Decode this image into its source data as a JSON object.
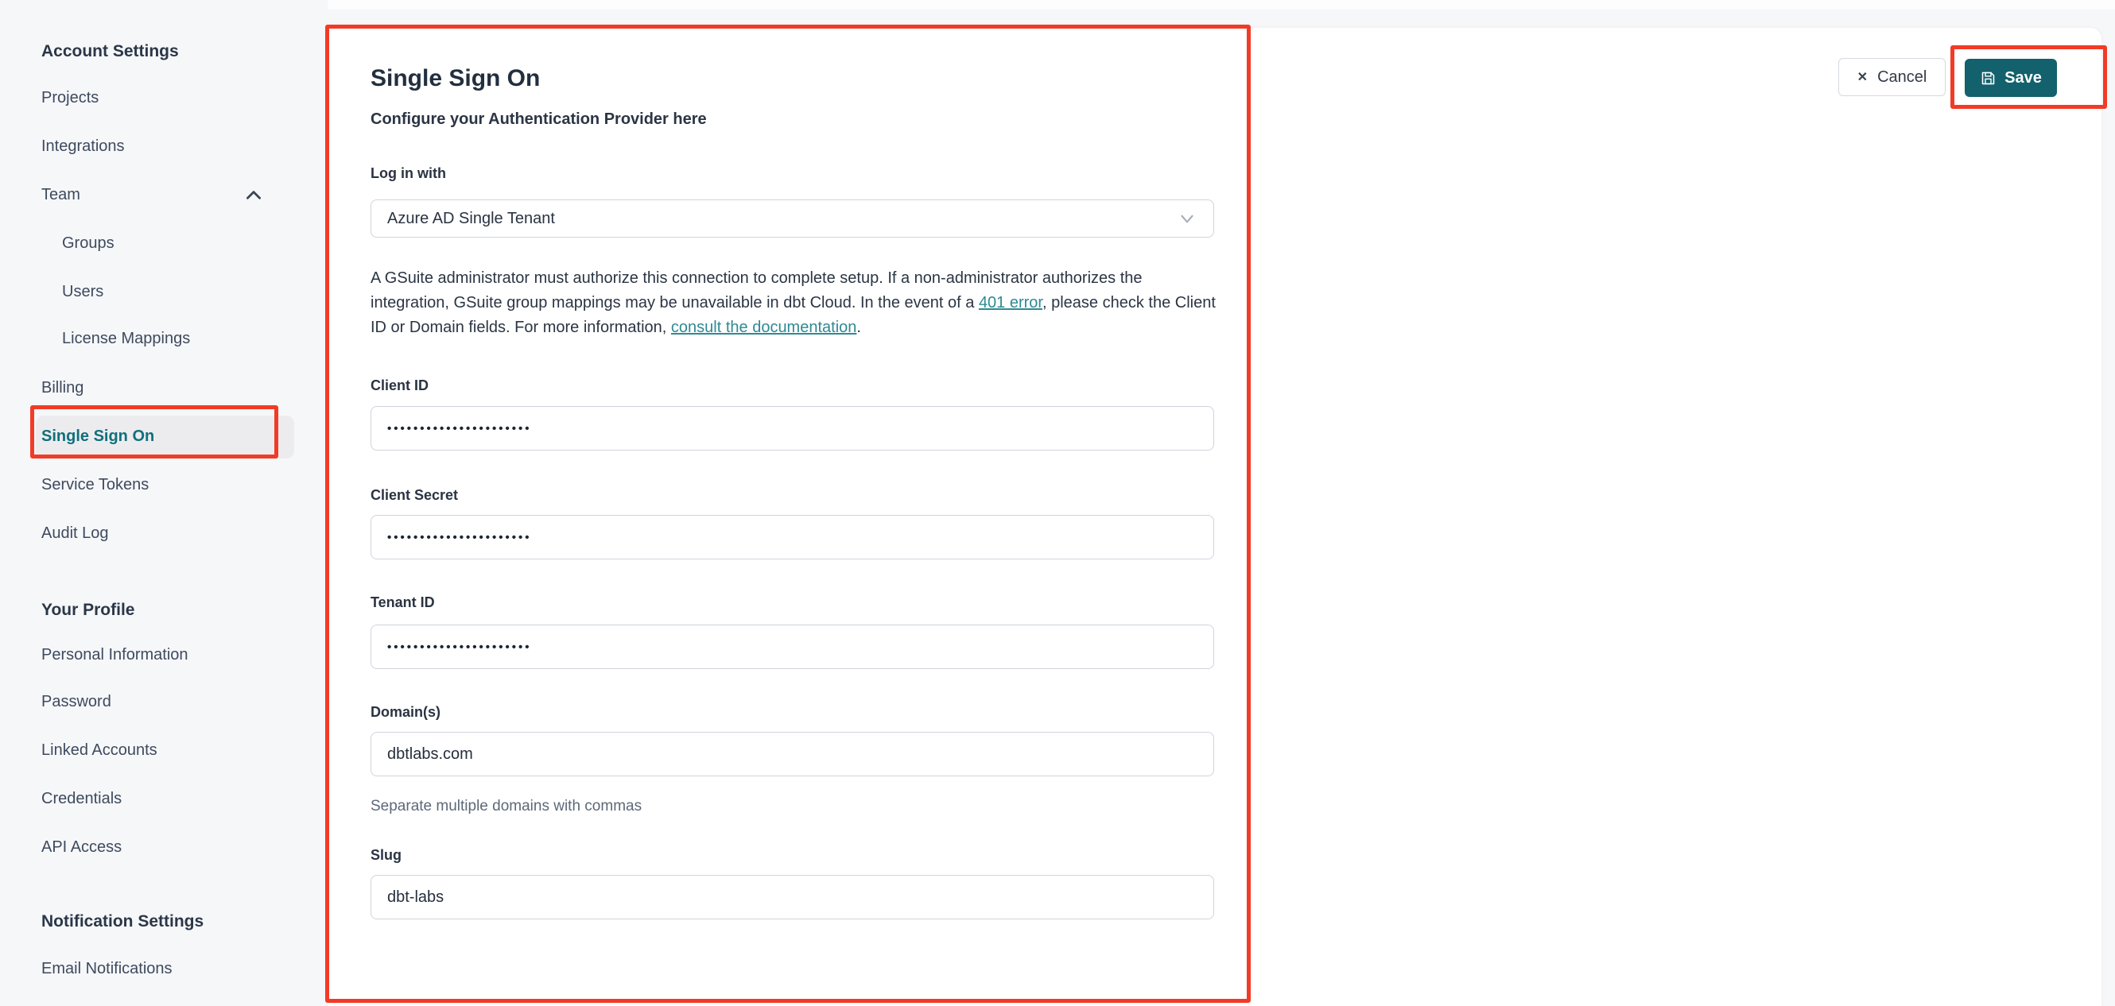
{
  "colors": {
    "accent_teal": "#10707c",
    "link_teal": "#2e8a93",
    "save_button_bg": "#12616c",
    "annotation_red": "#f23b26",
    "card_bg": "#ffffff",
    "page_bg": "#f6f7f9"
  },
  "sidebar": {
    "sections": [
      {
        "header": "Account Settings",
        "items": [
          {
            "label": "Projects"
          },
          {
            "label": "Integrations"
          },
          {
            "label": "Team",
            "expanded": true
          },
          {
            "label": "Groups",
            "indent": true
          },
          {
            "label": "Users",
            "indent": true
          },
          {
            "label": "License Mappings",
            "indent": true
          },
          {
            "label": "Billing"
          },
          {
            "label": "Single Sign On",
            "active": true
          },
          {
            "label": "Service Tokens"
          },
          {
            "label": "Audit Log"
          }
        ]
      },
      {
        "header": "Your Profile",
        "items": [
          {
            "label": "Personal Information"
          },
          {
            "label": "Password"
          },
          {
            "label": "Linked Accounts"
          },
          {
            "label": "Credentials"
          },
          {
            "label": "API Access"
          }
        ]
      },
      {
        "header": "Notification Settings",
        "items": [
          {
            "label": "Email Notifications"
          }
        ]
      }
    ]
  },
  "header": {
    "title": "Single Sign On",
    "subtitle": "Configure your Authentication Provider here",
    "cancel_label": "Cancel",
    "save_label": "Save",
    "cancel_icon": "✕"
  },
  "form": {
    "login_with": {
      "label": "Log in with",
      "value": "Azure AD Single Tenant"
    },
    "notice": {
      "p1": "A GSuite administrator must authorize this connection to complete setup. If a non-administrator authorizes the integration, GSuite group mappings may be unavailable in dbt Cloud. In the event of a ",
      "link1": "401 error",
      "p2": ", please check the Client ID or Domain fields. For more information, ",
      "link2": "consult the documentation",
      "p3": "."
    },
    "fields": [
      {
        "label": "Client ID",
        "value": "••••••••••••••••••••••",
        "masked": true
      },
      {
        "label": "Client Secret",
        "value": "••••••••••••••••••••••",
        "masked": true
      },
      {
        "label": "Tenant ID",
        "value": "••••••••••••••••••••••",
        "masked": true
      },
      {
        "label": "Domain(s)",
        "value": "dbtlabs.com",
        "masked": false,
        "helper": "Separate multiple domains with commas"
      },
      {
        "label": "Slug",
        "value": "dbt-labs",
        "masked": false
      }
    ]
  }
}
